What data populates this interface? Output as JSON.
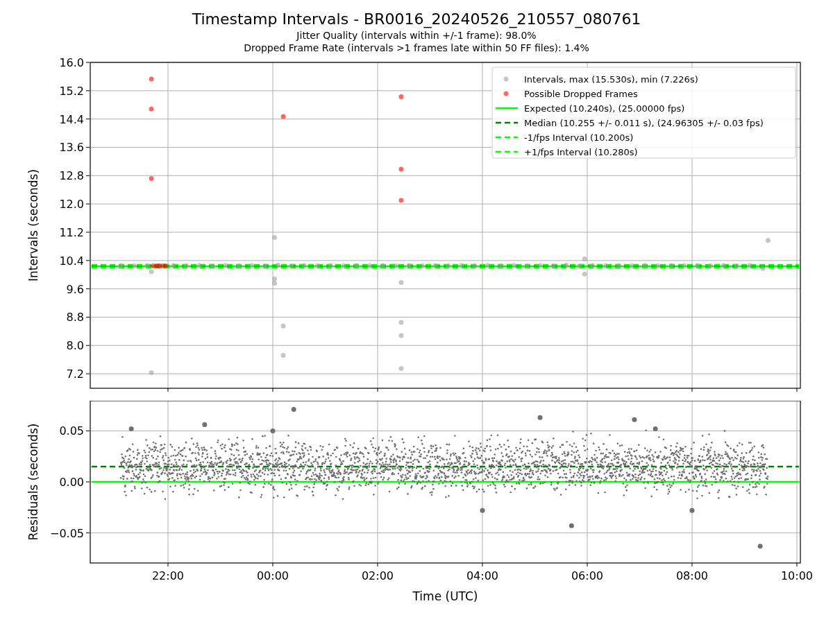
{
  "figure": {
    "title": "Timestamp Intervals - BR0016_20240526_210557_080761",
    "subtitles": [
      "Jitter Quality (intervals within +/-1 frame): 98.0%",
      "Dropped Frame Rate (intervals >1 frames late within 50 FF files): 1.4%"
    ]
  },
  "intervals_plot": {
    "chart_data": {
      "type": "scatter",
      "ylabel": "Intervals (seconds)",
      "legend": "upper right",
      "grid": true,
      "xlim": [
        "2024-05-26 20:31",
        "2024-05-27 10:04"
      ],
      "ylim": [
        6.79,
        16.0
      ],
      "yticks": [
        {
          "value": 7.2,
          "label": "7.2"
        },
        {
          "value": 8.0,
          "label": "8.0"
        },
        {
          "value": 8.8,
          "label": "8.8"
        },
        {
          "value": 9.6,
          "label": "9.6"
        },
        {
          "value": 10.4,
          "label": "10.4"
        },
        {
          "value": 11.2,
          "label": "11.2"
        },
        {
          "value": 12.0,
          "label": "12.0"
        },
        {
          "value": 12.8,
          "label": "12.8"
        },
        {
          "value": 13.6,
          "label": "13.6"
        },
        {
          "value": 14.4,
          "label": "14.4"
        },
        {
          "value": 15.2,
          "label": "15.2"
        },
        {
          "value": 16.0,
          "label": "16.0"
        }
      ],
      "series": [
        {
          "name": "Intervals, max (15.530s), min (7.226s)",
          "type": "scatter",
          "color": "#a0a0a0",
          "x": [
            "2024-05-26 21:06",
            "2024-05-26 21:21",
            "2024-05-26 21:36",
            "2024-05-26 21:51",
            "2024-05-26 22:06",
            "2024-05-26 22:21",
            "2024-05-26 22:36",
            "2024-05-26 22:51",
            "2024-05-26 23:06",
            "2024-05-26 23:21",
            "2024-05-26 23:36",
            "2024-05-26 23:51",
            "2024-05-27 00:06",
            "2024-05-27 00:21",
            "2024-05-27 00:36",
            "2024-05-27 00:51",
            "2024-05-27 01:06",
            "2024-05-27 01:21",
            "2024-05-27 01:36",
            "2024-05-27 01:51",
            "2024-05-27 02:06",
            "2024-05-27 02:21",
            "2024-05-27 02:36",
            "2024-05-27 02:51",
            "2024-05-27 03:06",
            "2024-05-27 03:21",
            "2024-05-27 03:36",
            "2024-05-27 03:51",
            "2024-05-27 04:06",
            "2024-05-27 04:21",
            "2024-05-27 04:36",
            "2024-05-27 04:51",
            "2024-05-27 05:06",
            "2024-05-27 05:21",
            "2024-05-27 05:36",
            "2024-05-27 05:51",
            "2024-05-27 06:06",
            "2024-05-27 06:21",
            "2024-05-27 06:36",
            "2024-05-27 06:51",
            "2024-05-27 07:06",
            "2024-05-27 07:21",
            "2024-05-27 07:36",
            "2024-05-27 07:51",
            "2024-05-27 08:06",
            "2024-05-27 08:21",
            "2024-05-27 08:36",
            "2024-05-27 08:51",
            "2024-05-27 09:06",
            "2024-05-27 09:21",
            "2024-05-26 21:41",
            "2024-05-26 21:41",
            "2024-05-27 00:02",
            "2024-05-27 00:02",
            "2024-05-27 00:02",
            "2024-05-27 00:12",
            "2024-05-27 00:12",
            "2024-05-27 02:27",
            "2024-05-27 02:27",
            "2024-05-27 02:27",
            "2024-05-27 02:27",
            "2024-05-27 05:57",
            "2024-05-27 05:57",
            "2024-05-27 09:27"
          ],
          "values": [
            10.26,
            10.25,
            10.26,
            10.25,
            10.26,
            10.25,
            10.26,
            10.25,
            10.26,
            10.25,
            10.26,
            10.25,
            10.27,
            10.25,
            10.26,
            10.25,
            10.26,
            10.25,
            10.26,
            10.25,
            10.26,
            10.25,
            10.26,
            10.25,
            10.26,
            10.25,
            10.26,
            10.25,
            10.26,
            10.25,
            10.26,
            10.25,
            10.26,
            10.25,
            10.27,
            10.25,
            10.26,
            10.25,
            10.26,
            10.25,
            10.26,
            10.25,
            10.26,
            10.25,
            10.26,
            10.25,
            10.26,
            10.25,
            10.26,
            10.18,
            7.23,
            10.08,
            11.05,
            9.88,
            9.76,
            8.55,
            7.72,
            9.78,
            8.65,
            8.28,
            7.35,
            10.45,
            10.02,
            10.97
          ]
        },
        {
          "name": "Possible Dropped Frames",
          "type": "scatter",
          "color": "#ff0000",
          "x": [
            "2024-05-26 21:41",
            "2024-05-26 21:41",
            "2024-05-26 21:41",
            "2024-05-27 00:12",
            "2024-05-27 02:27",
            "2024-05-27 02:27",
            "2024-05-27 02:27",
            "2024-05-26 21:43",
            "2024-05-26 21:47",
            "2024-05-26 21:50",
            "2024-05-26 21:54",
            "2024-05-26 21:57"
          ],
          "values": [
            15.53,
            14.68,
            12.72,
            14.47,
            15.03,
            12.98,
            12.1,
            10.25,
            10.25,
            10.25,
            10.25,
            10.25
          ]
        },
        {
          "name": "Expected (10.240s), (25.00000 fps)",
          "type": "line",
          "line_style": "solid",
          "color": "#00ff00",
          "x": [
            "2024-05-26 20:31",
            "2024-05-27 10:04"
          ],
          "values": [
            10.24,
            10.24
          ]
        },
        {
          "name": "Median (10.255 +/- 0.011 s), (24.96305 +/- 0.03 fps)",
          "type": "line",
          "line_style": "dashed",
          "color": "#008000",
          "x": [
            "2024-05-26 20:31",
            "2024-05-27 10:04"
          ],
          "values": [
            10.255,
            10.255
          ]
        },
        {
          "name": "-1/fps Interval (10.200s)",
          "type": "line",
          "line_style": "dashed",
          "color": "#00ff00",
          "x": [
            "2024-05-26 20:31",
            "2024-05-27 10:04"
          ],
          "values": [
            10.2,
            10.2
          ]
        },
        {
          "name": "+1/fps Interval (10.280s)",
          "type": "line",
          "line_style": "dashed",
          "color": "#00ff00",
          "x": [
            "2024-05-26 20:31",
            "2024-05-27 10:04"
          ],
          "values": [
            10.28,
            10.28
          ]
        }
      ]
    }
  },
  "residuals_plot": {
    "chart_data": {
      "type": "scatter",
      "xlabel": "Time (UTC)",
      "ylabel": "Residuals (seconds)",
      "grid": true,
      "xlim": [
        "2024-05-26 20:31",
        "2024-05-27 10:04"
      ],
      "ylim": [
        -0.0795,
        0.0795
      ],
      "xticks": [
        {
          "value": "2024-05-26 22:00",
          "label": "22:00"
        },
        {
          "value": "2024-05-27 00:00",
          "label": "00:00"
        },
        {
          "value": "2024-05-27 02:00",
          "label": "02:00"
        },
        {
          "value": "2024-05-27 04:00",
          "label": "04:00"
        },
        {
          "value": "2024-05-27 06:00",
          "label": "06:00"
        },
        {
          "value": "2024-05-27 08:00",
          "label": "08:00"
        },
        {
          "value": "2024-05-27 10:00",
          "label": "10:00"
        }
      ],
      "yticks": [
        {
          "value": -0.05,
          "label": "−0.05"
        },
        {
          "value": 0,
          "label": "0.00"
        },
        {
          "value": 0.05,
          "label": "0.05"
        }
      ],
      "series": [
        {
          "type": "scatter",
          "color": "#707070",
          "x": [
            "2024-05-26 21:18",
            "2024-05-26 22:42",
            "2024-05-27 00:24",
            "2024-05-27 00:00",
            "2024-05-27 05:06",
            "2024-05-27 06:54",
            "2024-05-27 07:18",
            "2024-05-27 09:18",
            "2024-05-27 08:00",
            "2024-05-27 04:00",
            "2024-05-27 05:42"
          ],
          "values": [
            0.052,
            0.056,
            0.071,
            0.05,
            0.063,
            0.061,
            0.052,
            -0.063,
            -0.028,
            -0.028,
            -0.043
          ]
        },
        {
          "type": "line",
          "line_style": "solid",
          "color": "#00ff00",
          "x": [
            "2024-05-26 20:31",
            "2024-05-27 10:04"
          ],
          "values": [
            0,
            0
          ]
        },
        {
          "type": "line",
          "line_style": "dashed",
          "color": "#008000",
          "x": [
            "2024-05-26 20:31",
            "2024-05-27 10:04"
          ],
          "values": [
            0.015,
            0.015
          ]
        }
      ]
    }
  }
}
